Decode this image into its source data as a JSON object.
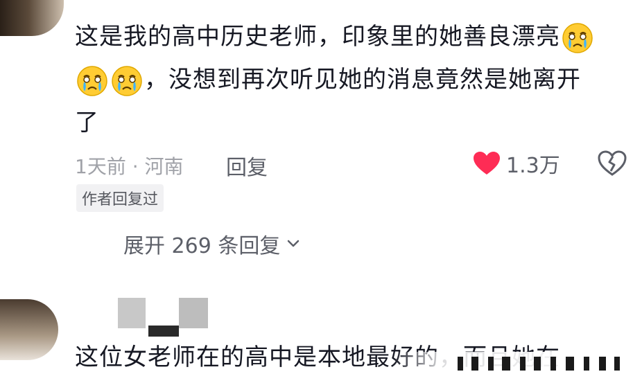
{
  "comment": {
    "line1": "这是我的高中历史老师，印象里的她善良漂亮",
    "line2": "，没想到再次听见她的消息竟然是她离开",
    "line3": "了",
    "time_location": "1天前 · 河南",
    "reply_label": "回复",
    "like_count": "1.3万",
    "author_replied_badge": "作者回复过",
    "expand_replies_label": "展开 269 条回复"
  },
  "next_comment": {
    "text": "这位女老师在的高中是本地最好的，而且她在"
  },
  "colors": {
    "like_heart": "#fe2c55",
    "meta_gray": "#a0a2a8",
    "text_dark": "#161823"
  },
  "icons": [
    "crying-face-emoji",
    "heart-icon",
    "broken-heart-icon",
    "chevron-down-icon"
  ]
}
